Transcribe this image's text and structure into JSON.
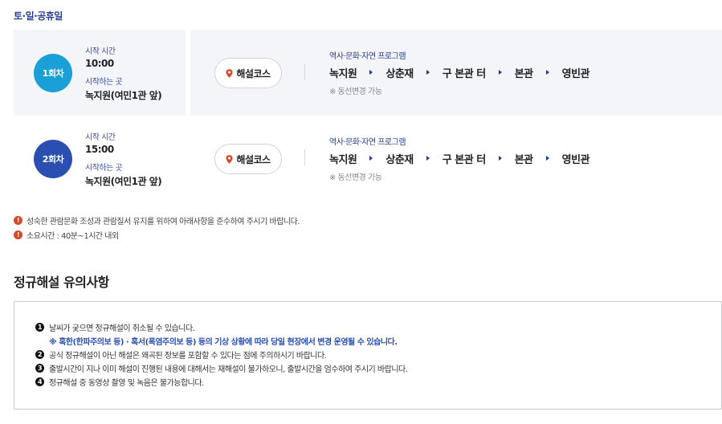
{
  "section_label": "토·일·공휴일",
  "sessions": [
    {
      "badge": "1회차",
      "badge_color": "#1a9fd6",
      "start_time_label": "시작 시간",
      "start_time": "10:00",
      "start_place_label": "시작하는 곳",
      "start_place": "녹지원(여민1관 앞)",
      "course_button": "해설코스",
      "program_title": "역사·문화·자연 프로그램",
      "route": [
        "녹지원",
        "상춘재",
        "구 본관 터",
        "본관",
        "영빈관"
      ],
      "note": "※ 동선변경 가능"
    },
    {
      "badge": "2회차",
      "badge_color": "#2a4fb0",
      "start_time_label": "시작 시간",
      "start_time": "15:00",
      "start_place_label": "시작하는 곳",
      "start_place": "녹지원(여민1관 앞)",
      "course_button": "해설코스",
      "program_title": "역사·문화·자연 프로그램",
      "route": [
        "녹지원",
        "상춘재",
        "구 본관 터",
        "본관",
        "영빈관"
      ],
      "note": "※ 동선변경 가능"
    }
  ],
  "notices": [
    "성숙한 관람문화 조성과 관람질서 유지를 위하여 아래사항을 준수하여 주시기 바랍니다.",
    "소요시간 : 40분~1시간 내외"
  ],
  "rules_heading": "정규해설 유의사항",
  "rules": [
    {
      "num": "1",
      "text": "날씨가 궂으면 정규해설이 취소될 수 있습니다."
    },
    {
      "num": "",
      "text": "※ 혹한(한파주의보 등) · 혹서(폭염주의보 등) 등의 기상 상황에 따라 당일 현장에서 변경 운영될 수 있습니다."
    },
    {
      "num": "2",
      "text": "공식 정규해설이 아닌 해설은 왜곡된 정보를 포함할 수 있다는 점에 주의하시기 바랍니다."
    },
    {
      "num": "3",
      "text": "출발시간이 지나 이미 해설이 진행된 내용에 대해서는 재해설이 불가하오니, 출발시간을 엄수하여 주시기 바랍니다."
    },
    {
      "num": "4",
      "text": "정규해설 중 동영상 촬영 및 녹음은 불가능합니다."
    }
  ],
  "icons": {
    "pin": "map-pin-icon",
    "arrow": "arrow-right-icon",
    "notice": "exclamation-icon"
  },
  "colors": {
    "accent_navy": "#2c3e8f",
    "pin_red": "#d9472b"
  }
}
